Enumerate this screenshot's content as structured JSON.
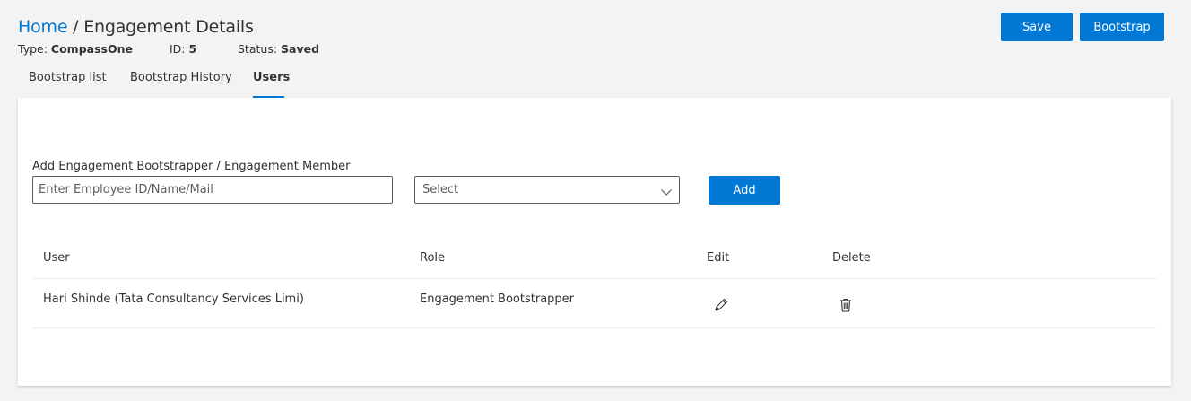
{
  "header": {
    "breadcrumb_home": "Home",
    "breadcrumb_separator": " / ",
    "breadcrumb_current": "Engagement Details",
    "type_label": "Type: ",
    "type_value": "CompassOne",
    "id_label": "ID: ",
    "id_value": "5",
    "status_label": "Status: ",
    "status_value": "Saved",
    "save_label": "Save",
    "bootstrap_label": "Bootstrap"
  },
  "tabs": [
    {
      "label": "Bootstrap list",
      "active": false
    },
    {
      "label": "Bootstrap History",
      "active": false
    },
    {
      "label": "Users",
      "active": true
    }
  ],
  "users_panel": {
    "field_label": "Add Engagement Bootstrapper / Engagement Member",
    "employee_input": {
      "value": "",
      "placeholder": "Enter Employee ID/Name/Mail"
    },
    "role_select": {
      "value": "Select"
    },
    "add_label": "Add",
    "columns": [
      "User",
      "Role",
      "Edit",
      "Delete"
    ],
    "rows": [
      {
        "user": "Hari Shinde (Tata Consultancy Services Limi)",
        "role": "Engagement Bootstrapper",
        "edit_icon": "pencil-icon",
        "delete_icon": "trash-icon"
      }
    ]
  },
  "colors": {
    "accent": "#0078d4",
    "page_background": "#f3f3f3",
    "card_background": "#ffffff",
    "text": "#323130"
  }
}
